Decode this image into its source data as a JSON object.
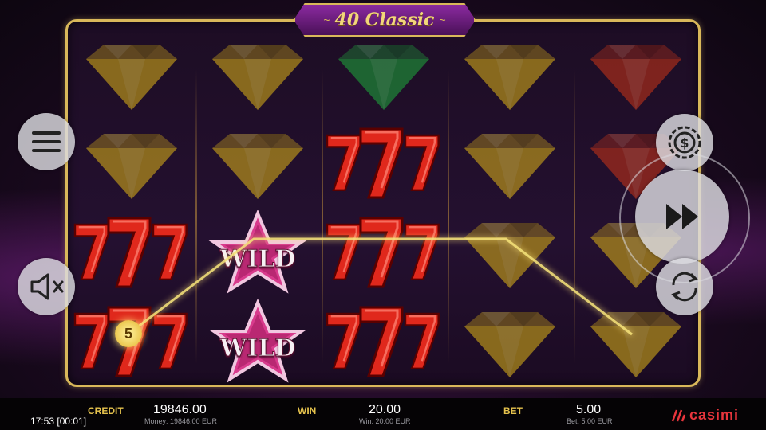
{
  "game": {
    "title": "40 Classic",
    "title_ornament_left": "~",
    "title_ornament_right": "~"
  },
  "reels": {
    "columns": 5,
    "rows": 4,
    "symbols": [
      [
        "diamond-gold",
        "diamond-gold",
        "seven",
        "seven"
      ],
      [
        "diamond-gold",
        "diamond-gold",
        "wild",
        "wild"
      ],
      [
        "diamond-green",
        "seven",
        "seven",
        "seven"
      ],
      [
        "diamond-gold",
        "diamond-gold",
        "diamond-gold",
        "diamond-gold"
      ],
      [
        "diamond-red",
        "diamond-red",
        "diamond-gold",
        "diamond-gold"
      ]
    ],
    "wild_label": "WILD",
    "colors": {
      "gold": "#c9a21a",
      "green": "#1f9a3a",
      "red": "#b8321a",
      "seven": "#e0281c",
      "wild": "#d83a8c"
    }
  },
  "win_line": {
    "number": "5"
  },
  "controls": {
    "menu": "menu-icon",
    "sound": "sound-muted-icon",
    "coin": "coin-icon",
    "spin": "fast-forward-icon",
    "autoplay": "autoplay-icon"
  },
  "bottom_bar": {
    "time": "17:53 [00:01]",
    "credit_label": "CREDIT",
    "credit_value": "19846.00",
    "credit_sub": "Money: 19846.00 EUR",
    "win_label": "WIN",
    "win_value": "20.00",
    "win_sub": "Win: 20.00 EUR",
    "bet_label": "BET",
    "bet_value": "5.00",
    "bet_sub": "Bet: 5.00 EUR",
    "brand": "casimi"
  }
}
